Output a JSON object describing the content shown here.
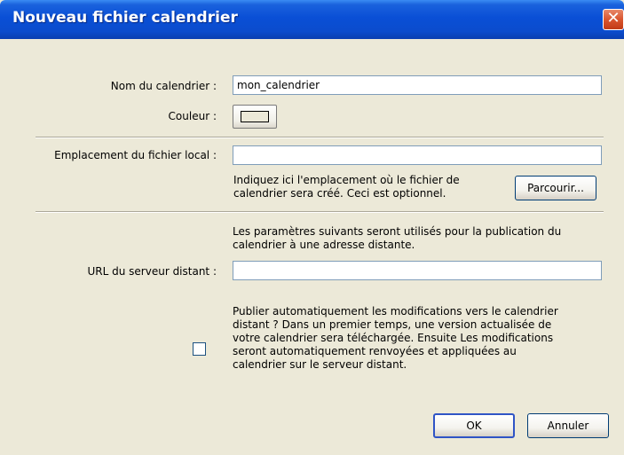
{
  "dialog": {
    "title": "Nouveau fichier calendrier",
    "close_glyph": "✕"
  },
  "name_section": {
    "name_label": "Nom du calendrier :",
    "name_value": "mon_calendrier",
    "color_label": "Couleur :"
  },
  "local_section": {
    "location_label": "Emplacement du fichier local :",
    "location_value": "",
    "hint_line1": "Indiquez ici l'emplacement où le fichier de",
    "hint_line2": "calendrier sera créé. Ceci est optionnel.",
    "browse_label": "Parcourir..."
  },
  "remote_section": {
    "intro_line1": "Les paramètres suivants seront utilisés pour la publication du",
    "intro_line2": "calendrier à une adresse distante.",
    "url_label": "URL du serveur distant :",
    "url_value": "",
    "auto_publish_checked": false,
    "auto_lines": [
      "Publier automatiquement les modifications vers le calendrier",
      "distant ? Dans un premier temps, une version actualisée de",
      "votre calendrier sera téléchargée. Ensuite Les modifications",
      "seront automatiquement renvoyées et appliquées au",
      "calendrier sur le serveur distant."
    ]
  },
  "footer": {
    "ok_label": "OK",
    "cancel_label": "Annuler"
  }
}
